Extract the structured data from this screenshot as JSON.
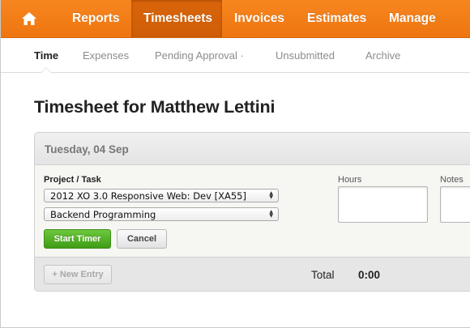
{
  "topnav": {
    "home_icon": "home-icon",
    "items": [
      {
        "label": "Reports"
      },
      {
        "label": "Timesheets"
      },
      {
        "label": "Invoices"
      },
      {
        "label": "Estimates"
      },
      {
        "label": "Manage"
      }
    ],
    "active": "Timesheets",
    "color": "#f47d17"
  },
  "subnav": {
    "items": [
      {
        "label": "Time"
      },
      {
        "label": "Expenses"
      },
      {
        "label": "Pending Approval ·"
      },
      {
        "label": "Unsubmitted"
      },
      {
        "label": "Archive"
      }
    ],
    "active": "Time"
  },
  "page": {
    "title": "Timesheet for Matthew Lettini"
  },
  "panel": {
    "date": "Tuesday, 04 Sep",
    "project_task_label": "Project / Task",
    "hours_label": "Hours",
    "notes_label": "Notes",
    "project_select": "2012 XO 3.0 Responsive Web: Dev [XA55]",
    "task_select": "Backend Programming",
    "start_timer": "Start Timer",
    "cancel": "Cancel",
    "new_entry": "+ New Entry",
    "total_label": "Total",
    "total_value": "0:00",
    "start_color": "#4caf22"
  }
}
